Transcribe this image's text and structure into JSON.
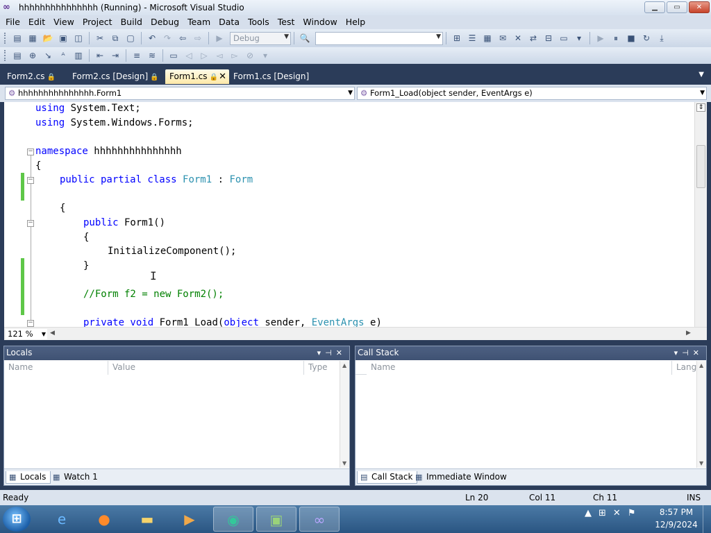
{
  "window": {
    "title": "hhhhhhhhhhhhhhh (Running) - Microsoft Visual Studio",
    "minimize": "▁",
    "maximize": "▭",
    "close": "✕"
  },
  "menu": [
    "File",
    "Edit",
    "View",
    "Project",
    "Build",
    "Debug",
    "Team",
    "Data",
    "Tools",
    "Test",
    "Window",
    "Help"
  ],
  "toolbar": {
    "config_value": "Debug",
    "find_value": ""
  },
  "doc_tabs": [
    {
      "label": "Form2.cs",
      "locked": "🔒"
    },
    {
      "label": "Form2.cs [Design]",
      "locked": "🔒"
    },
    {
      "label": "Form1.cs",
      "locked": "🔒",
      "active": true,
      "close": "✕"
    },
    {
      "label": "Form1.cs [Design]",
      "locked": "🔒"
    }
  ],
  "nav": {
    "type_combo": "hhhhhhhhhhhhhhh.Form1",
    "member_combo": "Form1_Load(object sender, EventArgs e)"
  },
  "code": {
    "l1_kw": "using",
    "l1_rest": " System.Text;",
    "l2_kw": "using",
    "l2_rest": " System.Windows.Forms;",
    "l3_kw": "namespace",
    "l3_rest": " hhhhhhhhhhhhhhh",
    "l4": "{",
    "l5_kw": "public partial class",
    "l5_type": "Form1",
    "l5_sep": " : ",
    "l5_base": "Form",
    "l6": "{",
    "l7_kw": "public",
    "l7_rest": " Form1()",
    "l8": "{",
    "l9": "InitializeComponent();",
    "l10": "}",
    "l11": "//Form f2 = new Form2();",
    "l12_kw": "private void",
    "l12_mid": " Form1 Load(",
    "l12_kw2": "object",
    "l12_mid2": " sender, ",
    "l12_type": "EventArgs",
    "l12_end": " e)"
  },
  "zoom": "121 %",
  "locals": {
    "title": "Locals",
    "columns": [
      "Name",
      "Value",
      "Type"
    ],
    "tabs": [
      "Locals",
      "Watch 1"
    ]
  },
  "callstack": {
    "title": "Call Stack",
    "columns": [
      "Name",
      "Lang"
    ],
    "tabs": [
      "Call Stack",
      "Immediate Window"
    ]
  },
  "status": {
    "state": "Ready",
    "ln": "Ln 20",
    "col": "Col 11",
    "ch": "Ch 11",
    "mode": "INS"
  },
  "taskbar": {
    "time": "8:57 PM",
    "date": "12/9/2024"
  },
  "colors": {
    "keyword": "#0000ff",
    "type": "#2b91af",
    "comment": "#008000",
    "changebar": "#5ec748"
  }
}
